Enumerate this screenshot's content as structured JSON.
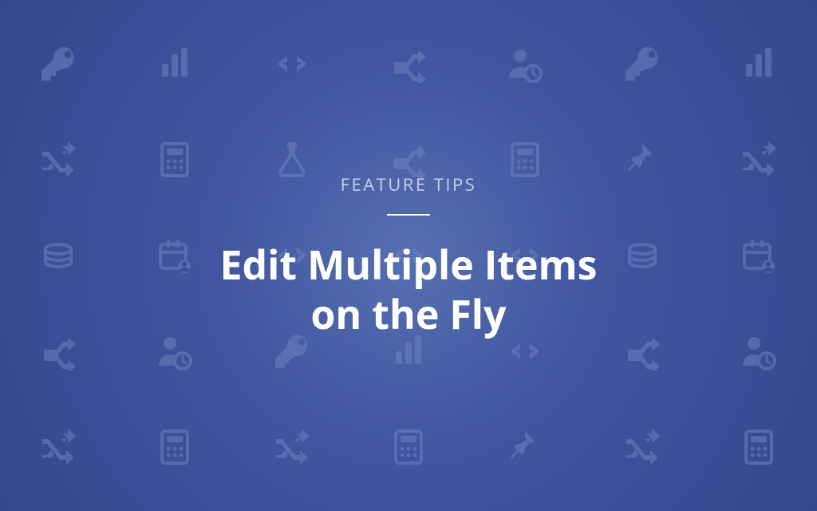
{
  "hero": {
    "eyebrow": "FEATURE TIPS",
    "headline_line1": "Edit Multiple Items",
    "headline_line2": "on the Fly"
  },
  "background_icons": {
    "rows": [
      [
        "key",
        "bar-chart",
        "code",
        "split",
        "user-clock",
        "key",
        "bar-chart"
      ],
      [
        "shuffle",
        "calculator",
        "flask",
        "split",
        "calculator",
        "pin",
        "shuffle"
      ],
      [
        "coins",
        "calendar-user",
        "code",
        "code",
        "code",
        "coins",
        "calendar-user"
      ],
      [
        "split",
        "user-clock",
        "key",
        "bar-chart",
        "code",
        "split",
        "user-clock"
      ],
      [
        "shuffle",
        "calculator",
        "shuffle",
        "calculator",
        "pin",
        "shuffle",
        "calculator"
      ]
    ]
  }
}
